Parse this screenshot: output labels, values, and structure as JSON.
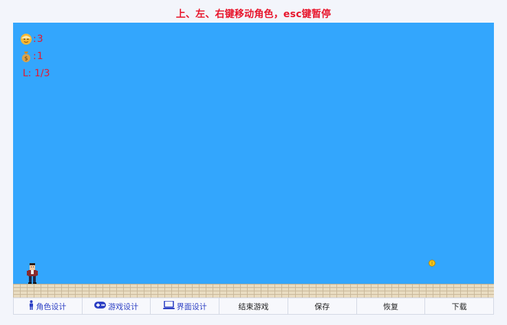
{
  "header": {
    "instructions": "上、左、右键移动角色，esc键暂停"
  },
  "hud": {
    "lives_icon": "player-face-icon",
    "lives_value": "3",
    "coins_icon": "money-bag-icon",
    "coins_value": "1",
    "level_label": "L: 1/3"
  },
  "toolbar": {
    "buttons": [
      {
        "label": "角色设计",
        "icon": "person-icon"
      },
      {
        "label": "游戏设计",
        "icon": "gamepad-icon"
      },
      {
        "label": "界面设计",
        "icon": "laptop-icon"
      },
      {
        "label": "结束游戏"
      },
      {
        "label": "保存"
      },
      {
        "label": "恢复"
      },
      {
        "label": "下载"
      }
    ]
  },
  "colors": {
    "sky": "#33a6fd",
    "hud_text": "#e8142b",
    "primary_button_text": "#2c3fc4"
  }
}
